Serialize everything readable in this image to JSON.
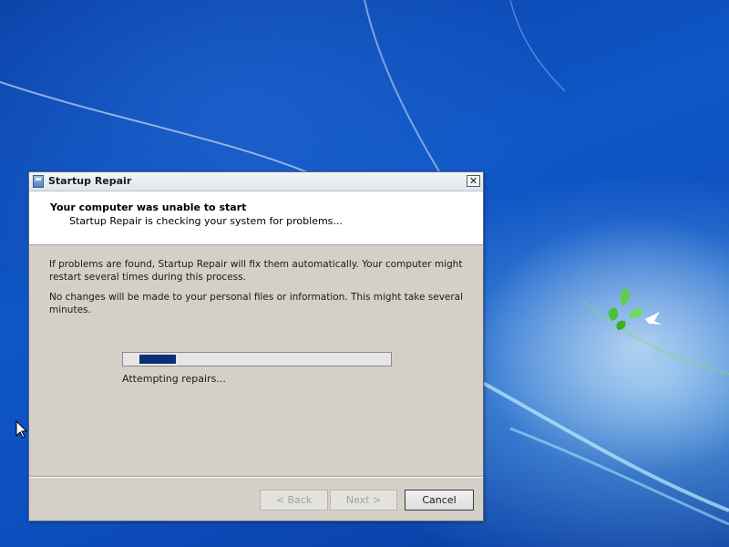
{
  "window": {
    "title": "Startup Repair",
    "close_glyph": "✕"
  },
  "header": {
    "heading": "Your computer was unable to start",
    "subheading": "Startup Repair is checking your system for problems..."
  },
  "body": {
    "paragraph1": "If problems are found, Startup Repair will fix them automatically. Your computer might restart several times during this process.",
    "paragraph2": "No changes will be made to your personal files or information. This might take several minutes."
  },
  "progress": {
    "status": "Attempting repairs...",
    "style": "indeterminate"
  },
  "buttons": {
    "back": "< Back",
    "next": "Next >",
    "cancel": "Cancel"
  },
  "icons": {
    "app": "startup-repair-icon",
    "close": "close-icon",
    "cursor": "mouse-pointer-icon"
  },
  "colors": {
    "desktop_blue": "#0f56c6",
    "dialog_face": "#d4d0c8",
    "progress_fill": "#0c2f78"
  }
}
